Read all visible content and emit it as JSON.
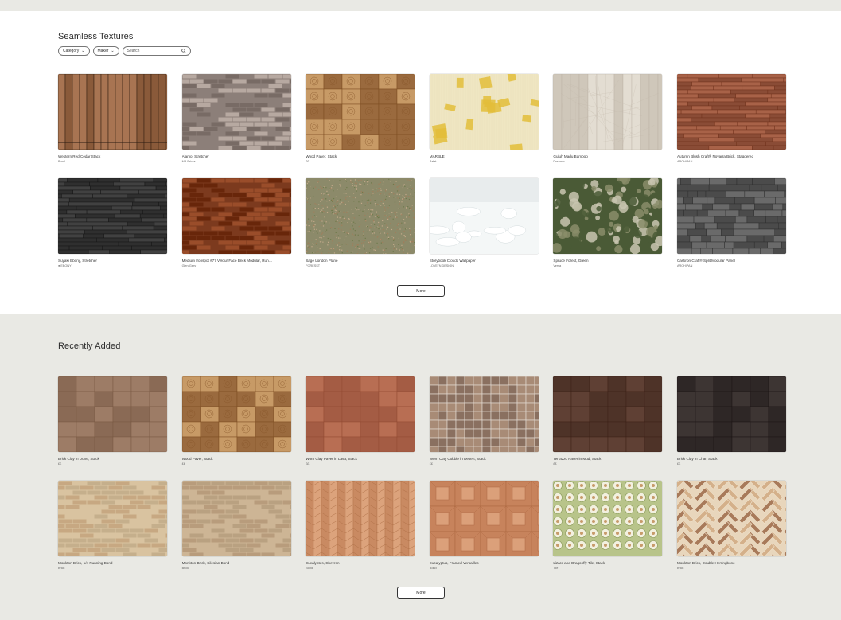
{
  "seamless": {
    "title": "Seamless Textures",
    "filters": {
      "category": "Category",
      "maker": "Maker",
      "search_placeholder": "Search"
    },
    "more_label": "More",
    "items": [
      {
        "title": "Western Red Cedar Stack",
        "maker": "Boral",
        "pattern": "wood-vertical",
        "c1": "#8a5a3a",
        "c2": "#a87452"
      },
      {
        "title": "Alamo, Stretcher",
        "maker": "MB Bricks",
        "pattern": "brick",
        "c1": "#8c7f79",
        "c2": "#b7a9a1"
      },
      {
        "title": "Wood Paver, Stack",
        "maker": "££",
        "pattern": "endgrain",
        "c1": "#9a6a3e",
        "c2": "#c79a66"
      },
      {
        "title": "MARBLE",
        "maker": "Palet.",
        "pattern": "yellow",
        "c1": "#efe6c2",
        "c2": "#e3bd3a"
      },
      {
        "title": "Guluh Madu Bamboo",
        "maker": "Dream.c",
        "pattern": "bamboo",
        "c1": "#cfc7ba",
        "c2": "#e3ddd2"
      },
      {
        "title": "Autumn Blush Craft® Novarra Brick, Staggered",
        "maker": "ARCHIPAN",
        "pattern": "plank-h",
        "c1": "#8a4c36",
        "c2": "#a86248"
      },
      {
        "title": "Suyaki Ebony, Stretcher",
        "maker": "● EBONY",
        "pattern": "dark-h",
        "c1": "#2f2f2f",
        "c2": "#414141"
      },
      {
        "title": "Medium Ironspot #77 Velour Face Brick Modular, Run…",
        "maker": "Glen-Gery",
        "pattern": "brick",
        "c1": "#7c3a1e",
        "c2": "#9a4d2a"
      },
      {
        "title": "Sage London Plane",
        "maker": "FORESST",
        "pattern": "speckle",
        "c1": "#8c8a6a",
        "c2": "#a07e5c"
      },
      {
        "title": "Storybook Clouds Wallpaper",
        "maker": "LOVE 'N DESIGN",
        "pattern": "clouds",
        "c1": "#dfe5e6",
        "c2": "#f4f7f7"
      },
      {
        "title": "Spruce Forest, Green",
        "maker": "Versa",
        "pattern": "forest",
        "c1": "#4a5a36",
        "c2": "#8a8d6a"
      },
      {
        "title": "Castiron Craft® Split Modular Panel",
        "maker": "ARCHIPAN",
        "pattern": "stone",
        "c1": "#4b4b4b",
        "c2": "#6a6a6a"
      }
    ]
  },
  "recent": {
    "title": "Recently Added",
    "more_label": "More",
    "items": [
      {
        "title": "Brick Clay in Dune, Stack",
        "maker": "££",
        "pattern": "tile-big",
        "c1": "#8a6a55",
        "c2": "#9d7c66"
      },
      {
        "title": "Wood Paver, Stack",
        "maker": "££",
        "pattern": "endgrain",
        "c1": "#9a6a3e",
        "c2": "#c79a66"
      },
      {
        "title": "Worn Clay Paver in Lava, Stack",
        "maker": "££",
        "pattern": "tile-big",
        "c1": "#a45c44",
        "c2": "#b86e53"
      },
      {
        "title": "Worn Clay Cobble in Desert, Stack",
        "maker": "££",
        "pattern": "tile-small",
        "c1": "#8a7060",
        "c2": "#a88b76"
      },
      {
        "title": "Terrazzo Paver in Mud, Stack",
        "maker": "££",
        "pattern": "tile-big",
        "c1": "#4e3328",
        "c2": "#5f4034"
      },
      {
        "title": "Brick Clay in Char, Stack",
        "maker": "££",
        "pattern": "tile-big",
        "c1": "#2e2726",
        "c2": "#3d3533"
      },
      {
        "title": "Monkton Brick, 1/4 Running Bond",
        "maker": "Brick",
        "pattern": "brick",
        "c1": "#d9c3a0",
        "c2": "#c7a882"
      },
      {
        "title": "Monkton Brick, Silesian Bond",
        "maker": "Brick",
        "pattern": "brick",
        "c1": "#cdb595",
        "c2": "#b89c7c"
      },
      {
        "title": "Eucalyptus, Chevron",
        "maker": "Bond",
        "pattern": "chevron",
        "c1": "#c98a62",
        "c2": "#dca37c"
      },
      {
        "title": "Eucalyptus, Framed Versailles",
        "maker": "Bond",
        "pattern": "versailles",
        "c1": "#c7835c",
        "c2": "#dba07a"
      },
      {
        "title": "Lizard and Dragonfly Tile, Stack",
        "maker": "Tile",
        "pattern": "ornament",
        "c1": "#b8c48a",
        "c2": "#f2f0df"
      },
      {
        "title": "Monkton Brick, Double Herringbone",
        "maker": "Brick",
        "pattern": "herringbone",
        "c1": "#d4b08a",
        "c2": "#a87a5a"
      }
    ]
  }
}
